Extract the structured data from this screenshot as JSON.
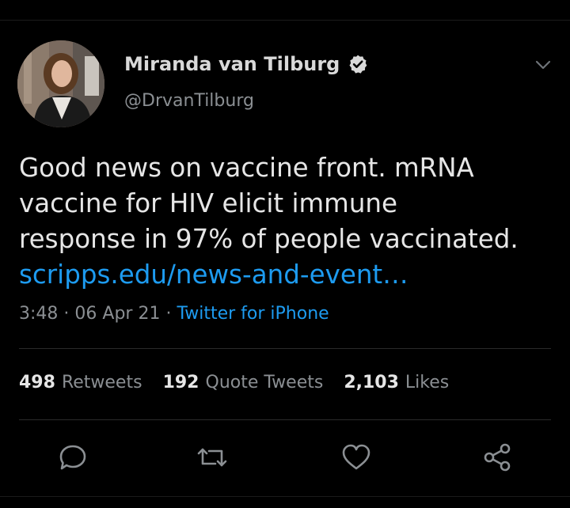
{
  "tweet": {
    "author_name": "Miranda van Tilburg",
    "author_handle": "@DrvanTilburg",
    "verified": true,
    "text_lines": [
      "Good news on vaccine front. mRNA",
      "vaccine for HIV elicit immune",
      "response in 97% of people vaccinated."
    ],
    "link_text": "scripps.edu/news-and-event…",
    "time": "3:48",
    "date": "06 Apr 21",
    "source": "Twitter for iPhone",
    "separator": "·"
  },
  "stats": {
    "retweets_count": "498",
    "retweets_label": "Retweets",
    "quotes_count": "192",
    "quotes_label": "Quote Tweets",
    "likes_count": "2,103",
    "likes_label": "Likes"
  },
  "actions": [
    "reply-icon",
    "retweet-icon",
    "like-icon",
    "share-icon"
  ],
  "colors": {
    "background": "#000000",
    "link": "#1d9bf0",
    "muted": "#8b8f93",
    "text": "#e6e6e6"
  }
}
